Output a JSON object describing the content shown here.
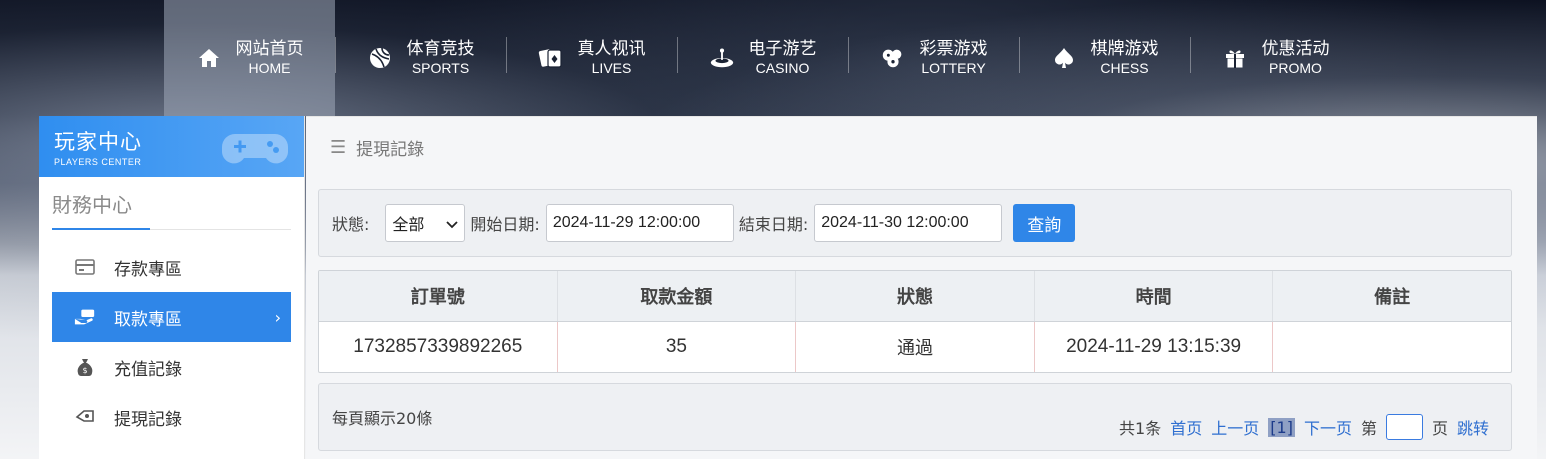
{
  "nav": [
    {
      "cn": "网站首页",
      "en": "HOME",
      "icon": "home-icon",
      "active": true
    },
    {
      "cn": "体育竞技",
      "en": "SPORTS",
      "icon": "ball-icon"
    },
    {
      "cn": "真人视讯",
      "en": "LIVES",
      "icon": "cards-icon"
    },
    {
      "cn": "电子游艺",
      "en": "CASINO",
      "icon": "roulette-icon"
    },
    {
      "cn": "彩票游戏",
      "en": "LOTTERY",
      "icon": "lottery-balls-icon"
    },
    {
      "cn": "棋牌游戏",
      "en": "CHESS",
      "icon": "spade-icon"
    },
    {
      "cn": "优惠活动",
      "en": "PROMO",
      "icon": "gift-icon"
    }
  ],
  "sidebar": {
    "banner_title": "玩家中心",
    "banner_sub": "PLAYERS CENTER",
    "section_title": "財務中心",
    "items": [
      {
        "label": "存款專區",
        "icon": "deposit-card-icon"
      },
      {
        "label": "取款專區",
        "icon": "withdraw-hand-icon",
        "active": true
      },
      {
        "label": "充值記錄",
        "icon": "money-bag-icon"
      },
      {
        "label": "提現記錄",
        "icon": "withdraw-record-icon"
      }
    ]
  },
  "main": {
    "breadcrumb": "提現記錄"
  },
  "filter": {
    "status_label": "狀態:",
    "status_value": "全部",
    "start_label": "開始日期:",
    "start_value": "2024-11-29 12:00:00",
    "end_label": "結束日期:",
    "end_value": "2024-11-30 12:00:00",
    "query_label": "查詢"
  },
  "table": {
    "headers": [
      "訂單號",
      "取款金額",
      "狀態",
      "時間",
      "備註"
    ],
    "rows": [
      [
        "1732857339892265",
        "35",
        "通過",
        "2024-11-29 13:15:39",
        ""
      ]
    ]
  },
  "pager": {
    "per_page": "每頁顯示20條",
    "total": "共1条",
    "first": "首页",
    "prev": "上一页",
    "current": "[1]",
    "next": "下一页",
    "page_prefix": "第",
    "page_suffix": "页",
    "jump": "跳转"
  },
  "colors": {
    "accent": "#2f86e8"
  }
}
